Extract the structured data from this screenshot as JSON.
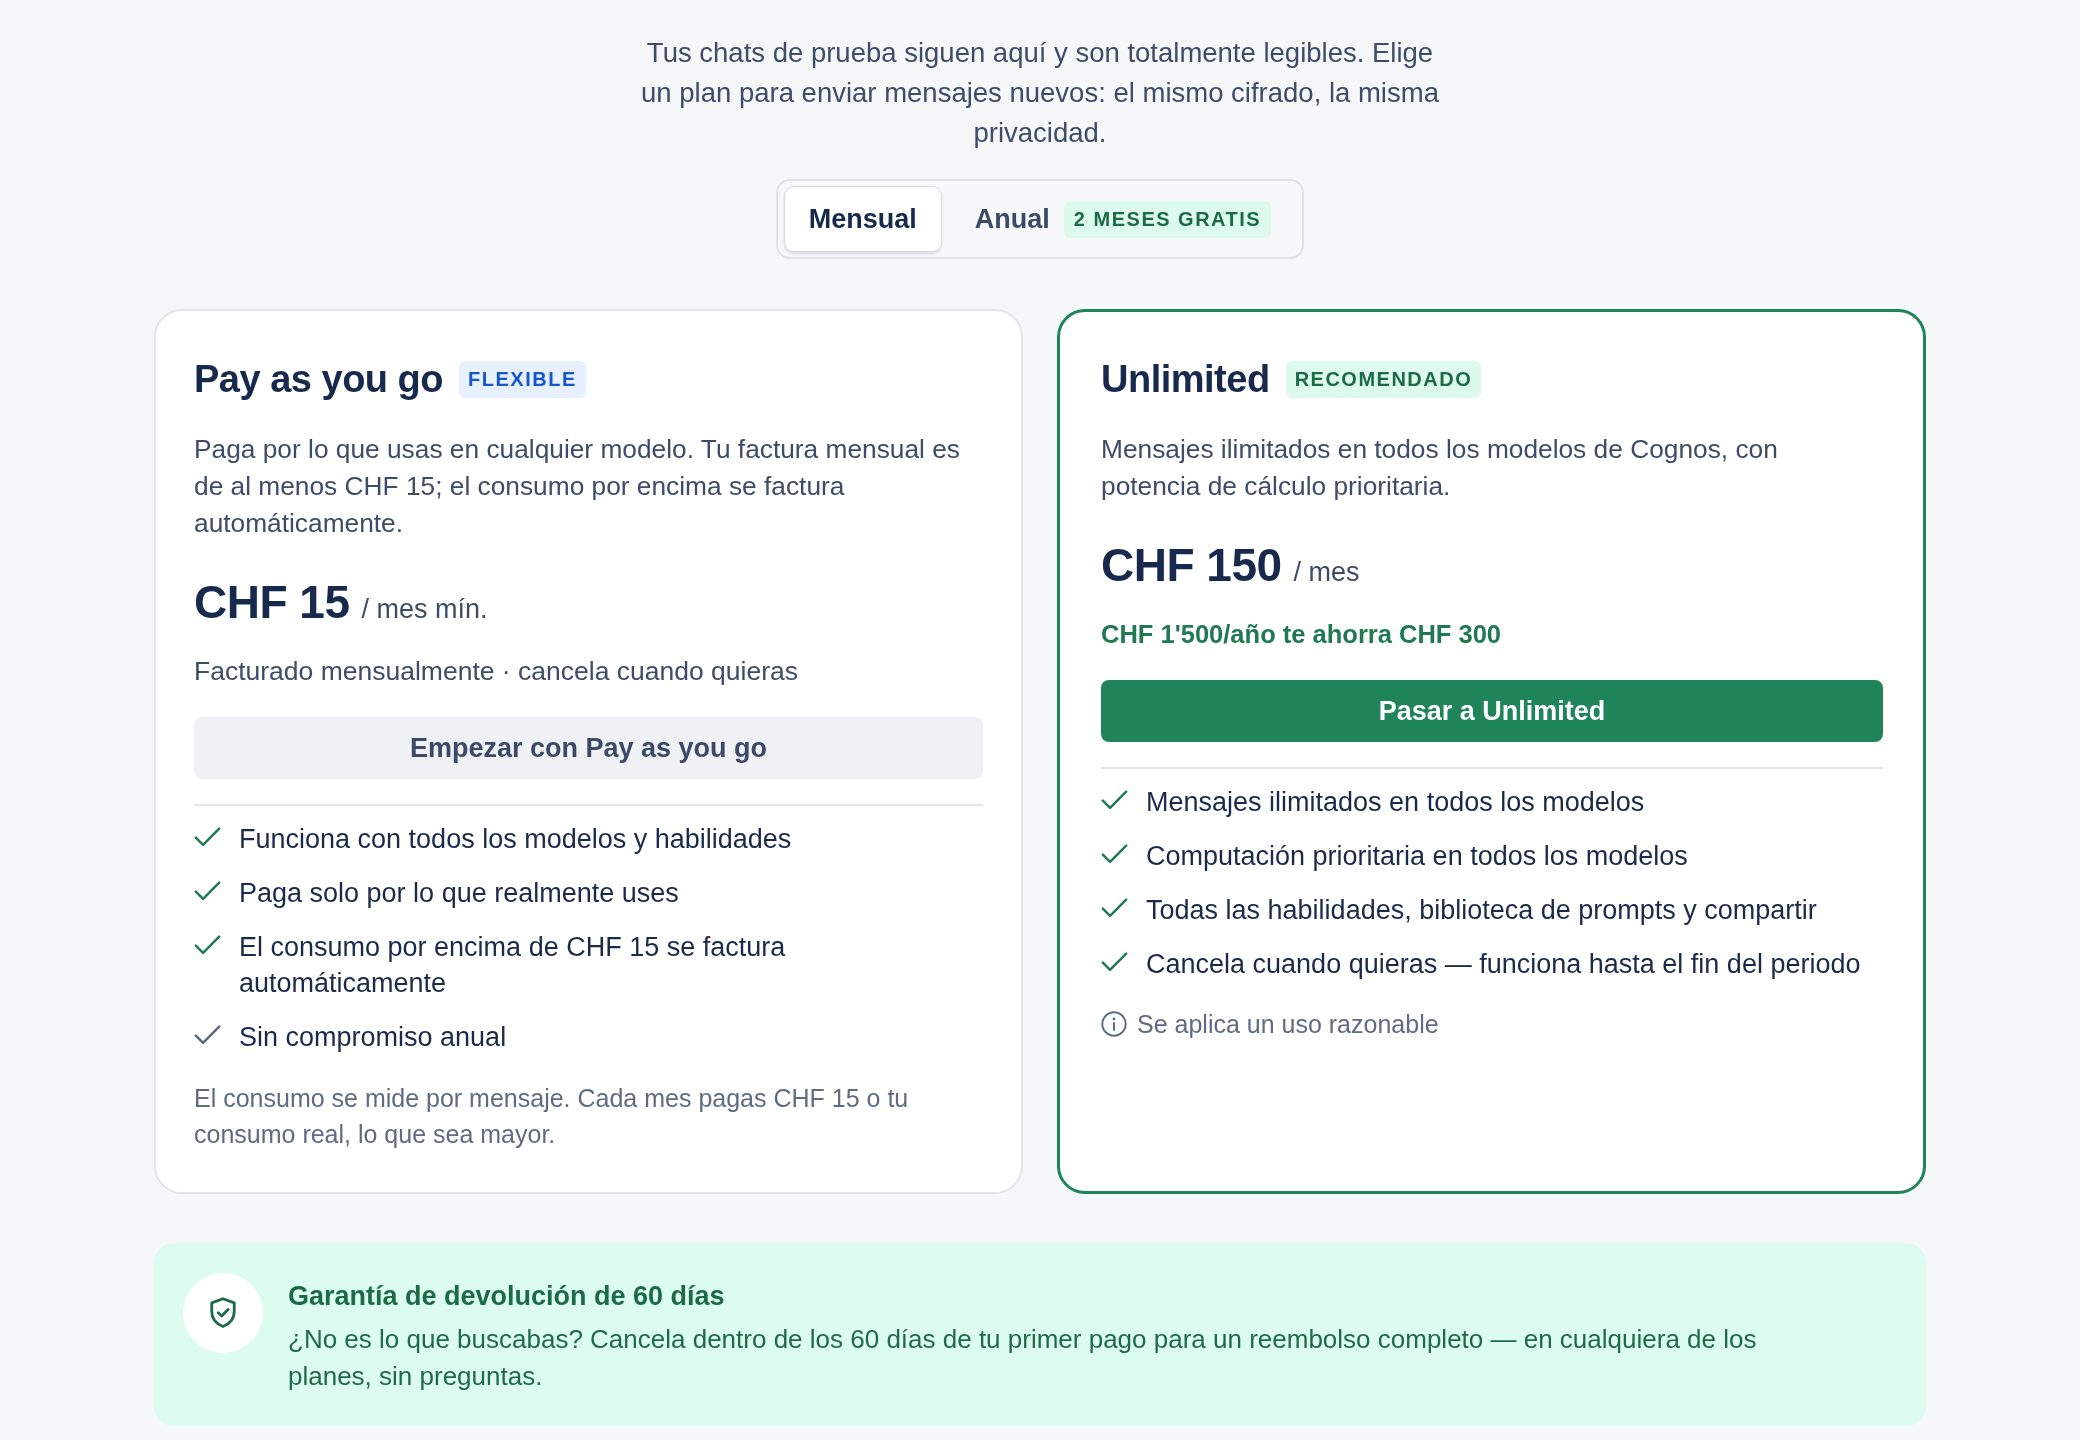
{
  "intro": {
    "text": "Tus chats de prueba siguen aquí y son totalmente legibles. Elige un plan para enviar mensajes nuevos: el mismo cifrado, la misma privacidad."
  },
  "billing_toggle": {
    "options": [
      {
        "label": "Mensual",
        "selected": true
      },
      {
        "label": "Anual",
        "selected": false,
        "badge": "2 MESES GRATIS"
      }
    ]
  },
  "plans": [
    {
      "name": "Pay as you go",
      "badge": "FLEXIBLE",
      "recommended": false,
      "description": "Paga por lo que usas en cualquier modelo. Tu factura mensual es de al menos CHF 15; el consumo por encima se factura automáticamente.",
      "price": "CHF 15",
      "period": "/ mes mín.",
      "price_note": {
        "kind": "plain",
        "text": "Facturado mensualmente · cancela cuando quieras"
      },
      "button": "Empezar con Pay as you go",
      "features": [
        {
          "text": "Funciona con todos los modelos y habilidades",
          "muted": false
        },
        {
          "text": "Paga solo por lo que realmente uses",
          "muted": false
        },
        {
          "text": "El consumo por encima de CHF 15 se factura automáticamente",
          "muted": false
        },
        {
          "text": "Sin compromiso anual",
          "muted": true
        }
      ],
      "footnote": {
        "kind": "plain",
        "text": "El consumo se mide por mensaje. Cada mes pagas CHF 15 o tu consumo real, lo que sea mayor."
      }
    },
    {
      "name": "Unlimited",
      "badge": "RECOMENDADO",
      "recommended": true,
      "description": "Mensajes ilimitados en todos los modelos de Cognos, con potencia de cálculo prioritaria.",
      "price": "CHF 150",
      "period": "/ mes",
      "price_note": {
        "kind": "savings",
        "text": "CHF 1'500/año te ahorra CHF 300"
      },
      "button": "Pasar a Unlimited",
      "features": [
        {
          "text": "Mensajes ilimitados en todos los modelos",
          "muted": false
        },
        {
          "text": "Computación prioritaria en todos los modelos",
          "muted": false
        },
        {
          "text": "Todas las habilidades, biblioteca de prompts y compartir",
          "muted": false
        },
        {
          "text": "Cancela cuando quieras — funciona hasta el fin del periodo",
          "muted": false
        }
      ],
      "footnote": {
        "kind": "info",
        "text": "Se aplica un uso razonable"
      }
    }
  ],
  "guarantee": {
    "title": "Garantía de devolución de 60 días",
    "text": "¿No es lo que buscabas? Cancela dentro de los 60 días de tu primer pago para un reembolso completo — en cualquiera de los planes, sin preguntas."
  }
}
